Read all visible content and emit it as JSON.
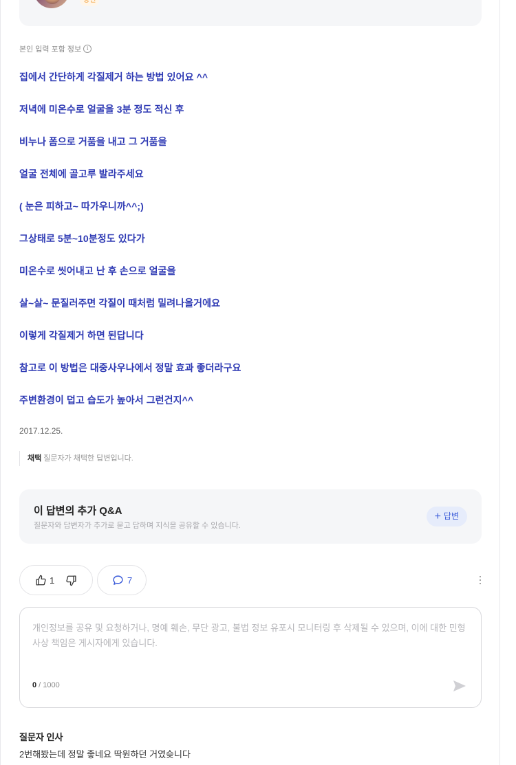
{
  "profile": {
    "badge": "당신"
  },
  "answer": {
    "info_label": "본인 입력 포함 정보",
    "info_icon": "i",
    "lines": [
      "집에서 간단하게 각질제거 하는 방법 있어요 ^^",
      "저녁에 미온수로 얼굴을 3분 정도 적신 후",
      "비누나 폼으로 거품을 내고 그 거품을",
      "얼굴 전체에 골고루 발라주세요",
      "( 눈은 피하고~ 따가우니까^^;)",
      "그상태로 5분~10분정도 있다가",
      "미온수로 씻어내고 난 후 손으로 얼굴을",
      "살~살~ 문질러주면 각질이 때처럼 밀려나올거에요",
      "이렇게 각질제거 하면 된답니다",
      "참고로 이 방법은 대중사우나에서 정말 효과 좋더라구요",
      "주변환경이 덥고 습도가 높아서 그런건지^^"
    ],
    "date": "2017.12.25.",
    "adopted_label": "채택",
    "adopted_text": "질문자가 채택한 답변입니다."
  },
  "qa": {
    "title": "이 답변의 추가 Q&A",
    "description": "질문자와 답변자가 추가로 묻고 답하며 지식을 공유할 수 있습니다.",
    "button_plus": "+",
    "button_label": "답변"
  },
  "actions": {
    "like_count": "1",
    "comment_count": "7"
  },
  "comment": {
    "placeholder": "개인정보를 공유 및 요청하거나, 명예 훼손, 무단 광고, 불법 정보 유포시 모니터링 후 삭제될 수 있으며, 이에 대한 민형사상 책임은 게시자에게 있습니다.",
    "count_current": "0",
    "count_max": " / 1000"
  },
  "greeting": {
    "title": "질문자 인사",
    "text": "2번해봤는데 정말 좋네요 딱원하던 거였슺니다"
  },
  "colors": {
    "answer_text": "#2e3ab4",
    "accent": "#3a5bd9",
    "badge": "#f29a2e"
  }
}
